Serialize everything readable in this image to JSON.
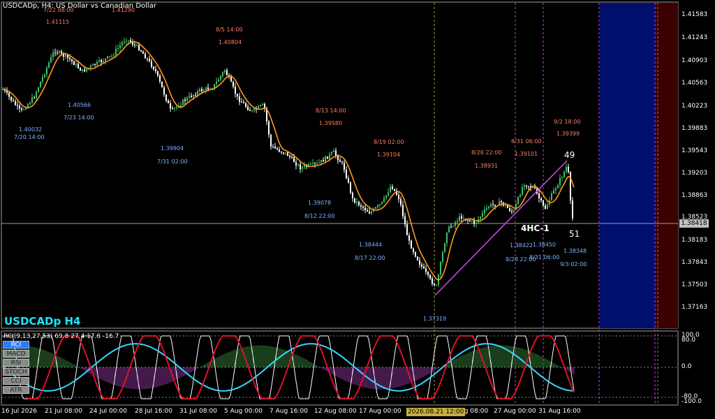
{
  "chart_title": "USDCADp, H4: US Dollar vs Canadian Dollar",
  "symbol_label": "USDCADp H4",
  "indicator_header": "RCI(9,13,27,53) 69.8 27.4 17.6 -16.7",
  "indicator_buttons": [
    "RCI",
    "MACD",
    "RSI",
    "STOCH",
    "CCI",
    "ATR"
  ],
  "active_indicator": "RCI",
  "colors": {
    "bull": "#3fc06a",
    "bear": "#ffffff",
    "ma": "#ff9a1f",
    "trend": "#c946e6",
    "hi_label": "#ff7f63",
    "lo_label": "#7fb3ff",
    "zone_blue": "#000e6e",
    "zone_red": "#3b0000",
    "rci_white": "#ffffff",
    "rci_red": "#e0102a",
    "rci_cyan": "#3ad6ff"
  },
  "price_axis": [
    "1.41583",
    "1.41243",
    "1.40903",
    "1.40563",
    "1.40223",
    "1.39883",
    "1.39543",
    "1.39203",
    "1.38863",
    "1.38523",
    "1.38183",
    "1.37843",
    "1.37503",
    "1.37163"
  ],
  "current_price": "1.38418",
  "indicator_axis": [
    "100.0",
    "80.0",
    "0.0",
    "-80.0",
    "-100.0"
  ],
  "time_axis": [
    "16 Jul 2026",
    "21 Jul 08:00",
    "24 Jul 00:00",
    "28 Jul 16:00",
    "31 Jul 08:00",
    "5 Aug 00:00",
    "7 Aug 16:00",
    "12 Aug 08:00",
    "17 Aug 00:00",
    "ug 08:00",
    "27 Aug 00:00",
    "31 Aug 16:00"
  ],
  "time_cursor": "2026.08.21 12:00",
  "wave_label": "4HC-1",
  "count_labels": [
    "49",
    "51"
  ],
  "high_labels": [
    {
      "date": "7/22 08:00",
      "price": "1.41115"
    },
    {
      "date": "",
      "price": "1.41290"
    },
    {
      "date": "8/5 14:00",
      "price": "1.40804"
    },
    {
      "date": "8/13 14:00",
      "price": "1.39580"
    },
    {
      "date": "8/19 02:00",
      "price": "1.39104"
    },
    {
      "date": "8/26 22:00",
      "price": "1.38931"
    },
    {
      "date": "8/31 06:00",
      "price": "1.39101"
    },
    {
      "date": "9/2 18:00",
      "price": "1.39399"
    }
  ],
  "low_labels": [
    {
      "date": "7/20 14:00",
      "price": "1.40032"
    },
    {
      "date": "7/23 14:00",
      "price": "1.40566"
    },
    {
      "date": "7/31 02:00",
      "price": "1.39904"
    },
    {
      "date": "8/12 22:00",
      "price": "1.39078"
    },
    {
      "date": "8/17 22:00",
      "price": "1.38444"
    },
    {
      "date": "",
      "price": "1.37319"
    },
    {
      "date": "8/28 22:00",
      "price": "1.38422"
    },
    {
      "date": "8/31 06:00",
      "price": "1.38450"
    },
    {
      "date": "9/3 02:00",
      "price": "1.38348"
    }
  ]
}
